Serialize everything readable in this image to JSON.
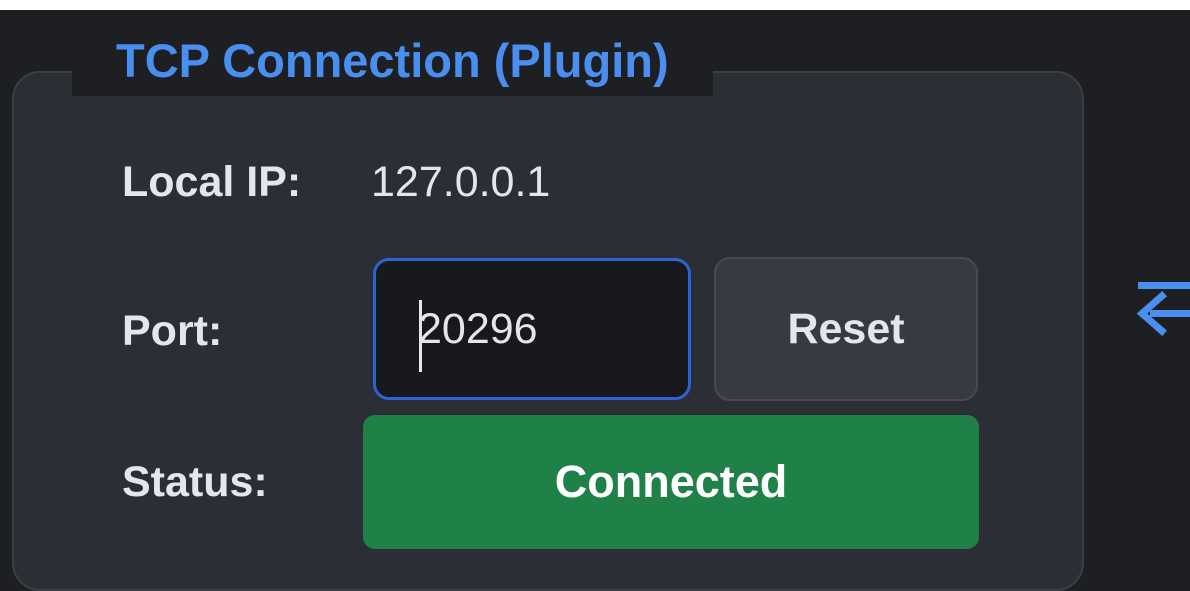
{
  "group": {
    "title": "TCP Connection (Plugin)"
  },
  "local_ip": {
    "label": "Local IP:",
    "value": "127.0.0.1"
  },
  "port": {
    "label": "Port:",
    "value": "20296",
    "reset_label": "Reset"
  },
  "status": {
    "label": "Status:",
    "value": "Connected",
    "color": "#1f8048"
  },
  "colors": {
    "accent": "#4a8ff0",
    "background": "#1e1f22",
    "panel": "#2c2e35"
  },
  "icons": {
    "side_arrow": "arrow-left-to-line-icon"
  }
}
